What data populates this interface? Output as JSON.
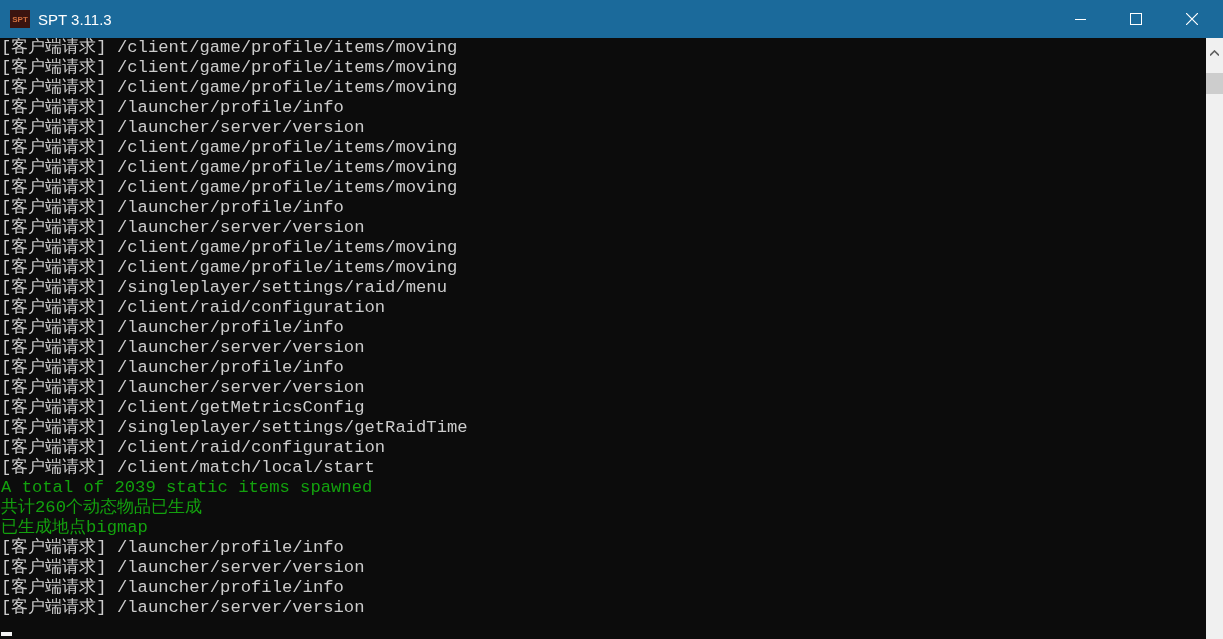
{
  "window": {
    "title": "SPT 3.11.3",
    "icon_text": "SPT"
  },
  "console": {
    "lines": [
      {
        "kind": "request",
        "text": "[客户端请求] /client/game/profile/items/moving"
      },
      {
        "kind": "request",
        "text": "[客户端请求] /client/game/profile/items/moving"
      },
      {
        "kind": "request",
        "text": "[客户端请求] /client/game/profile/items/moving"
      },
      {
        "kind": "request",
        "text": "[客户端请求] /launcher/profile/info"
      },
      {
        "kind": "request",
        "text": "[客户端请求] /launcher/server/version"
      },
      {
        "kind": "request",
        "text": "[客户端请求] /client/game/profile/items/moving"
      },
      {
        "kind": "request",
        "text": "[客户端请求] /client/game/profile/items/moving"
      },
      {
        "kind": "request",
        "text": "[客户端请求] /client/game/profile/items/moving"
      },
      {
        "kind": "request",
        "text": "[客户端请求] /launcher/profile/info"
      },
      {
        "kind": "request",
        "text": "[客户端请求] /launcher/server/version"
      },
      {
        "kind": "request",
        "text": "[客户端请求] /client/game/profile/items/moving"
      },
      {
        "kind": "request",
        "text": "[客户端请求] /client/game/profile/items/moving"
      },
      {
        "kind": "request",
        "text": "[客户端请求] /singleplayer/settings/raid/menu"
      },
      {
        "kind": "request",
        "text": "[客户端请求] /client/raid/configuration"
      },
      {
        "kind": "request",
        "text": "[客户端请求] /launcher/profile/info"
      },
      {
        "kind": "request",
        "text": "[客户端请求] /launcher/server/version"
      },
      {
        "kind": "request",
        "text": "[客户端请求] /launcher/profile/info"
      },
      {
        "kind": "request",
        "text": "[客户端请求] /launcher/server/version"
      },
      {
        "kind": "request",
        "text": "[客户端请求] /client/getMetricsConfig"
      },
      {
        "kind": "request",
        "text": "[客户端请求] /singleplayer/settings/getRaidTime"
      },
      {
        "kind": "request",
        "text": "[客户端请求] /client/raid/configuration"
      },
      {
        "kind": "request",
        "text": "[客户端请求] /client/match/local/start"
      },
      {
        "kind": "success",
        "text": "A total of 2039 static items spawned"
      },
      {
        "kind": "success",
        "text": "共计260个动态物品已生成"
      },
      {
        "kind": "success",
        "text": "已生成地点bigmap"
      },
      {
        "kind": "request",
        "text": "[客户端请求] /launcher/profile/info"
      },
      {
        "kind": "request",
        "text": "[客户端请求] /launcher/server/version"
      },
      {
        "kind": "request",
        "text": "[客户端请求] /launcher/profile/info"
      },
      {
        "kind": "request",
        "text": "[客户端请求] /launcher/server/version"
      }
    ]
  }
}
